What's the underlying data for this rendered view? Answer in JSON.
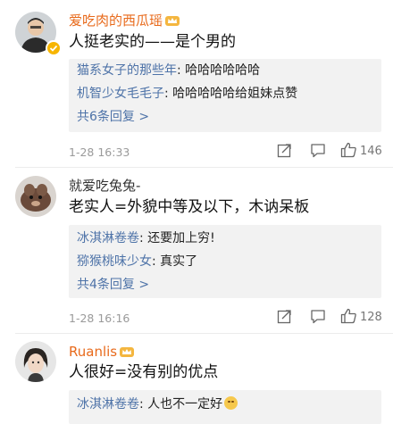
{
  "comments": [
    {
      "username": "爱吃肉的西瓜瑶",
      "text": "人挺老实的——是个男的",
      "replies": [
        {
          "name": "猫系女子的那些年",
          "text": "哈哈哈哈哈哈"
        },
        {
          "name": "机智少女毛毛子",
          "text": "哈哈哈哈哈给姐妹点赞"
        }
      ],
      "more": "共6条回复 >",
      "time": "1-28 16:33",
      "likes": "146"
    },
    {
      "username": "就爱吃兔兔-",
      "text": "老实人=外貌中等及以下，木讷呆板",
      "replies": [
        {
          "name": "冰淇淋卷卷",
          "text": "还要加上穷!"
        },
        {
          "name": "猕猴桃味少女",
          "text": "真实了"
        }
      ],
      "more": "共4条回复 >",
      "time": "1-28 16:16",
      "likes": "128"
    },
    {
      "username": "Ruanlis",
      "text": "人很好=没有别的优点",
      "replies": [
        {
          "name": "冰淇淋卷卷",
          "text": "人也不一定好"
        }
      ]
    }
  ],
  "colors": {
    "username_accent": "#e86a1b",
    "reply_name": "#4e73a8",
    "verified_badge": "#f7b500"
  },
  "icons": [
    "share-icon",
    "comment-icon",
    "like-icon",
    "verified-badge-icon",
    "level-crown-icon",
    "smile-emoji-icon"
  ]
}
